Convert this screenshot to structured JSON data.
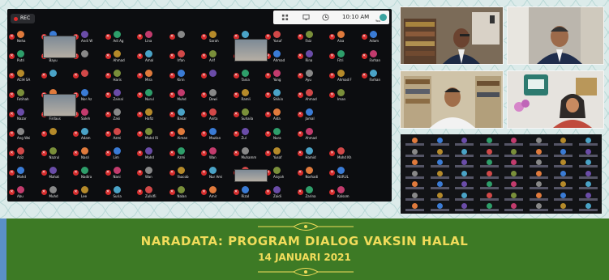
{
  "meeting": {
    "rec_label": "REC",
    "clock": "10:10 AM",
    "host_tag": "You"
  },
  "colors": {
    "footer_green": "#3d7a25",
    "title_yellow": "#f1dc5a",
    "mic_red": "#d62b2b"
  },
  "icons": [
    "microphone-muted-icon",
    "record-icon",
    "grid-view-icon",
    "monitor-icon",
    "clock-icon"
  ],
  "participants": [
    [
      "Neha",
      "Rohit",
      "Andi W",
      "Adi Ag",
      "Lina",
      "",
      "Sarah",
      "",
      "Yusuf",
      "Faiz",
      "Aisa",
      "Adam"
    ],
    [
      "Putri",
      "Bayu",
      "",
      "Ahmad",
      "Amal",
      "Irfan",
      "Arif",
      "Ali",
      "Ahmad",
      "Rina",
      "Fitri",
      "Farhan"
    ],
    [
      "ACIH SA",
      "",
      "",
      "Haris",
      "Mira",
      "Kirin",
      "",
      "Tania",
      "Yong",
      "Ayu",
      "Ahmad F",
      "Farhan"
    ],
    [
      "Fatihah",
      "Hafizah",
      "Nor Az",
      "Zainal",
      "Nurul",
      "Muhd",
      "Dewi",
      "Ramli",
      "Shikin",
      "Ahmad",
      "Iman"
    ],
    [
      "Nazar",
      "Firdaus",
      "Saleh",
      "Zaki",
      "Hafiz",
      "Bakar",
      "Anita",
      "Suhaila",
      "Aida",
      "Jamal"
    ],
    [
      "Ang Wei",
      "",
      "Adam",
      "Azmi",
      "Mohd Ri",
      "Aiman",
      "Mazlan",
      "Zul",
      "Nura",
      "Ahmad"
    ],
    [
      "Aziz",
      "Nazrul",
      "Nasri",
      "Lim",
      "Mohd",
      "Azmi",
      "Wan",
      "Muhamm",
      "Yusof",
      "Hamid",
      "Mohd Kh"
    ],
    [
      "Mohd",
      "Mahat",
      "Nadira",
      "Nani",
      "Wan",
      "Yaacob",
      "Nur Ami",
      "Hajar",
      "Aisyah",
      "Norhadi",
      "NURUL"
    ],
    [
      "Abu",
      "Muhd",
      "Lee",
      "Suria",
      "Zulkifli",
      "Nalan",
      "Amir",
      "Rizal",
      "Zaidi",
      "Zarina",
      "Kalsom"
    ],
    [
      "Siti",
      "Emy",
      "NURHA",
      "Aina",
      "Izwan",
      "Nabila",
      "Muhd A",
      "Rosli",
      "Hadi",
      "Nurul",
      "Fadli"
    ],
    [
      "Syed",
      "Alia",
      "Radzi",
      "Zaini",
      "Sakura",
      "Fahmi",
      "Syahira",
      "Ruzaini",
      "Ariff"
    ],
    [
      "Fatin",
      "Kharul",
      "Normah",
      "Mardi",
      "Aqilah",
      "Mahani",
      "Nadia",
      "Syahmi",
      "Azlina",
      "Syafiq",
      "Hazmi"
    ],
    [
      "Kamal",
      "Mahmud",
      "Amin",
      "Zahra",
      "Liyana",
      "Suria",
      "Sabri",
      "Anis",
      "Zamri",
      "Hanis"
    ],
    [
      "Syahid",
      "Dali",
      "Farouk",
      "Wahab",
      "Rahim",
      "Amirul",
      "Sophia",
      "Iskandar",
      "Ali Uzair",
      "",
      "Syafiqah"
    ]
  ],
  "banner": {
    "title": "NARADATA: PROGRAM DIALOG VAKSIN HALAL",
    "date": "14 JANUARI 2021"
  }
}
